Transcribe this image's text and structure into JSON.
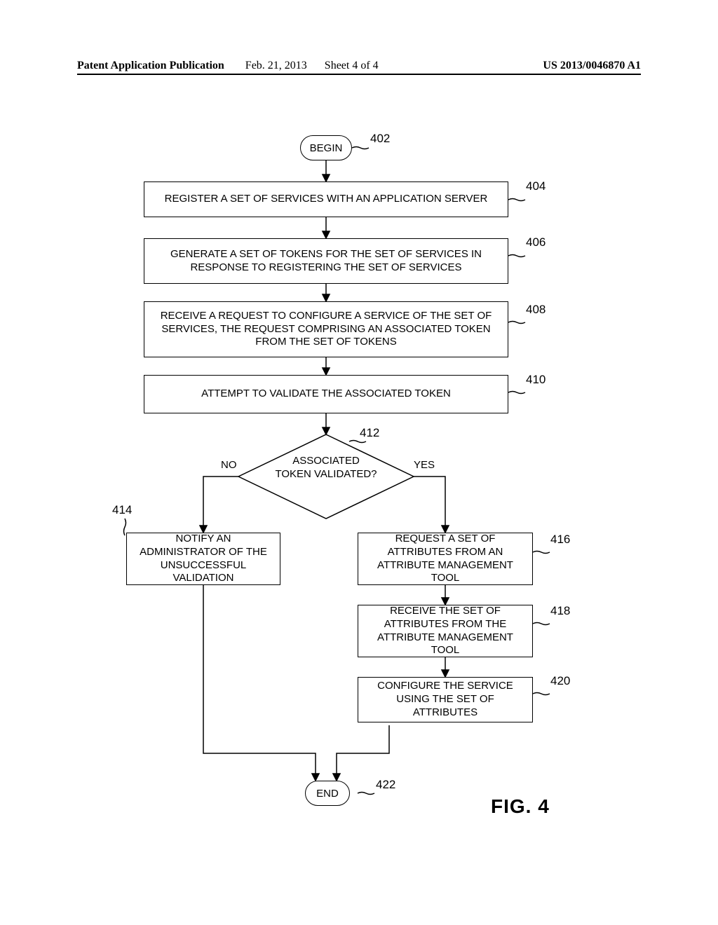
{
  "header": {
    "publication": "Patent Application Publication",
    "date": "Feb. 21, 2013",
    "sheet": "Sheet 4 of 4",
    "docnum": "US 2013/0046870 A1"
  },
  "refs": {
    "begin": "402",
    "b404": "404",
    "b406": "406",
    "b408": "408",
    "b410": "410",
    "d412": "412",
    "b414": "414",
    "b416": "416",
    "b418": "418",
    "b420": "420",
    "end": "422"
  },
  "boxes": {
    "begin": "BEGIN",
    "b404": "REGISTER A SET OF SERVICES WITH AN APPLICATION SERVER",
    "b406": "GENERATE A SET OF TOKENS FOR THE SET OF SERVICES IN RESPONSE TO REGISTERING THE SET OF SERVICES",
    "b408": "RECEIVE A REQUEST TO CONFIGURE A SERVICE OF THE SET OF SERVICES, THE REQUEST COMPRISING AN ASSOCIATED TOKEN FROM THE SET OF TOKENS",
    "b410": "ATTEMPT TO VALIDATE THE ASSOCIATED TOKEN",
    "d412": "ASSOCIATED TOKEN VALIDATED?",
    "b414": "NOTIFY AN ADMINISTRATOR OF THE UNSUCCESSFUL VALIDATION",
    "b416": "REQUEST A SET OF ATTRIBUTES FROM AN ATTRIBUTE MANAGEMENT TOOL",
    "b418": "RECEIVE THE SET OF ATTRIBUTES FROM THE ATTRIBUTE MANAGEMENT TOOL",
    "b420": "CONFIGURE THE SERVICE USING THE SET OF ATTRIBUTES",
    "end": "END"
  },
  "labels": {
    "no": "NO",
    "yes": "YES"
  },
  "figure": "FIG. 4",
  "chart_data": {
    "type": "flowchart",
    "title": "FIG. 4",
    "nodes": [
      {
        "id": "402",
        "type": "terminator",
        "label": "BEGIN"
      },
      {
        "id": "404",
        "type": "process",
        "label": "REGISTER A SET OF SERVICES WITH AN APPLICATION SERVER"
      },
      {
        "id": "406",
        "type": "process",
        "label": "GENERATE A SET OF TOKENS FOR THE SET OF SERVICES IN RESPONSE TO REGISTERING THE SET OF SERVICES"
      },
      {
        "id": "408",
        "type": "process",
        "label": "RECEIVE A REQUEST TO CONFIGURE A SERVICE OF THE SET OF SERVICES, THE REQUEST COMPRISING AN ASSOCIATED TOKEN FROM THE SET OF TOKENS"
      },
      {
        "id": "410",
        "type": "process",
        "label": "ATTEMPT TO VALIDATE THE ASSOCIATED TOKEN"
      },
      {
        "id": "412",
        "type": "decision",
        "label": "ASSOCIATED TOKEN VALIDATED?"
      },
      {
        "id": "414",
        "type": "process",
        "label": "NOTIFY AN ADMINISTRATOR OF THE UNSUCCESSFUL VALIDATION"
      },
      {
        "id": "416",
        "type": "process",
        "label": "REQUEST A SET OF ATTRIBUTES FROM AN ATTRIBUTE MANAGEMENT TOOL"
      },
      {
        "id": "418",
        "type": "process",
        "label": "RECEIVE THE SET OF ATTRIBUTES FROM THE ATTRIBUTE MANAGEMENT TOOL"
      },
      {
        "id": "420",
        "type": "process",
        "label": "CONFIGURE THE SERVICE USING THE SET OF ATTRIBUTES"
      },
      {
        "id": "422",
        "type": "terminator",
        "label": "END"
      }
    ],
    "edges": [
      {
        "from": "402",
        "to": "404"
      },
      {
        "from": "404",
        "to": "406"
      },
      {
        "from": "406",
        "to": "408"
      },
      {
        "from": "408",
        "to": "410"
      },
      {
        "from": "410",
        "to": "412"
      },
      {
        "from": "412",
        "to": "414",
        "label": "NO"
      },
      {
        "from": "412",
        "to": "416",
        "label": "YES"
      },
      {
        "from": "416",
        "to": "418"
      },
      {
        "from": "418",
        "to": "420"
      },
      {
        "from": "420",
        "to": "422"
      },
      {
        "from": "414",
        "to": "422"
      }
    ]
  }
}
